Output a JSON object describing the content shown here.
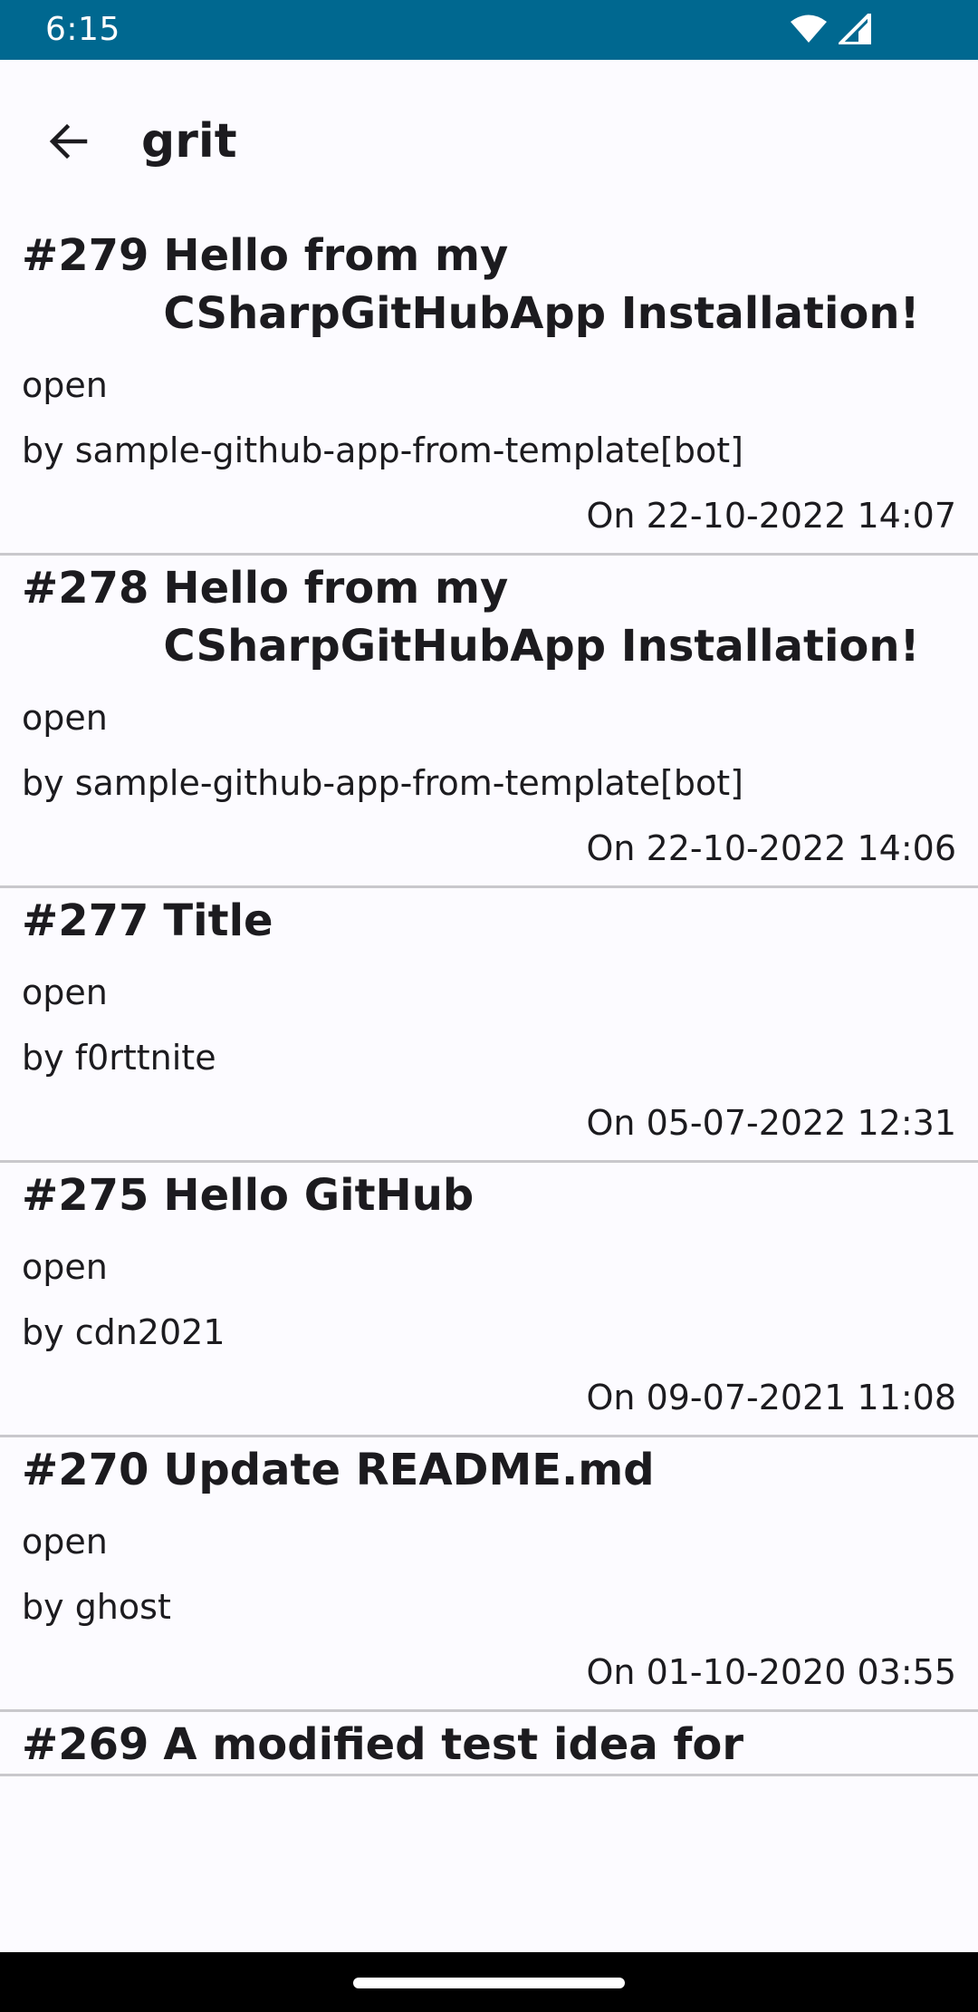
{
  "status_bar": {
    "time": "6:15",
    "icons": [
      "wifi-icon",
      "cell-signal-icon"
    ]
  },
  "app_bar": {
    "back_icon": "arrow-back-icon",
    "title": "grit"
  },
  "issues": [
    {
      "number": "#279",
      "title": "Hello from my CSharpGitHubApp Installation!",
      "state": "open",
      "author": "by sample-github-app-from-template[bot]",
      "date": "On 22-10-2022 14:07"
    },
    {
      "number": "#278",
      "title": "Hello from my CSharpGitHubApp Installation!",
      "state": "open",
      "author": "by sample-github-app-from-template[bot]",
      "date": "On 22-10-2022 14:06"
    },
    {
      "number": "#277",
      "title": "Title",
      "state": "open",
      "author": "by f0rttnite",
      "date": "On 05-07-2022 12:31"
    },
    {
      "number": "#275",
      "title": "Hello GitHub",
      "state": "open",
      "author": "by cdn2021",
      "date": "On 09-07-2021 11:08"
    },
    {
      "number": "#270",
      "title": "Update README.md",
      "state": "open",
      "author": "by ghost",
      "date": "On 01-10-2020 03:55"
    },
    {
      "number": "#269",
      "title": "A modified test idea for",
      "state": "",
      "author": "",
      "date": ""
    }
  ],
  "colors": {
    "status_bar": "#006890",
    "background": "#FCFBFF",
    "text": "#1C1B1F",
    "divider": "#C9C8CC",
    "nav_bar": "#000000"
  }
}
